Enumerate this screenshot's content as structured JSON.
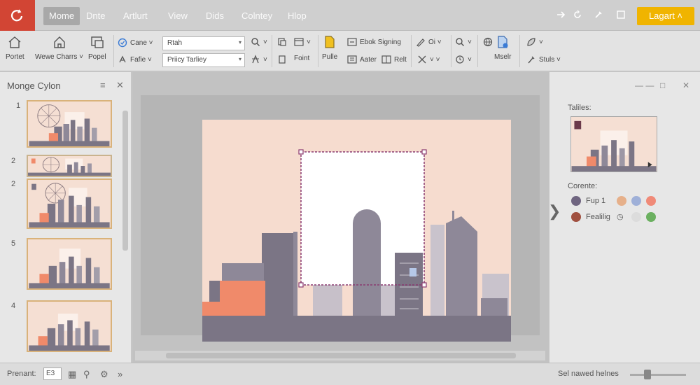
{
  "tabs": [
    "Mome",
    "Dnte",
    "Artlurt",
    "View",
    "Dids",
    "Colntey",
    "Hlop"
  ],
  "active_tab": "Mome",
  "start_button": "Lagart ˄",
  "ribbon": {
    "big": [
      {
        "id": "paste",
        "label": "Portet"
      },
      {
        "id": "view-charts",
        "label": "Wewe Charrs ˅"
      },
      {
        "id": "popel",
        "label": "Popel"
      }
    ],
    "dropdown_1_label": "Cane ˅",
    "dropdown_2_label": "Fafie ˅",
    "font_input": "Rtah",
    "size_input": "Priicy Tarliey",
    "font_btn": "Foint",
    "pulle": "Pulle",
    "book_signing": "Ebok Signing",
    "after": "Aater",
    "rest": "Relt",
    "oi": "Oi ˅",
    "meetr": "Mselr",
    "stuls": "Stuls ˅"
  },
  "left_panel": {
    "title": "Monge Cylon",
    "slides": [
      "1",
      "2",
      "2",
      "5",
      "4"
    ]
  },
  "right_panel": {
    "tables_label": "Taliles:",
    "colors_label": "Corente:",
    "swatch_1": "Fup 1",
    "swatch_2": "Fealilig",
    "colors": {
      "c1": "#6f6580",
      "c2": "#e6b08a",
      "c3": "#9fb0d8",
      "c4": "#f08a78",
      "c5": "#a05040",
      "c6": "#dcdcdc",
      "c7": "#6bb060"
    }
  },
  "status": {
    "left": "Prenant:",
    "zoom_value": "E3",
    "right": "Sel nawed helnes"
  }
}
